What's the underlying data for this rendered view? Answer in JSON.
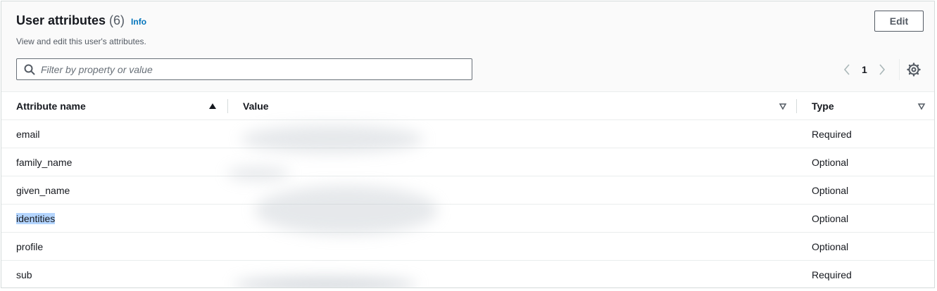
{
  "header": {
    "title": "User attributes",
    "count": "(6)",
    "info_label": "Info",
    "description": "View and edit this user's attributes.",
    "edit_label": "Edit"
  },
  "search": {
    "placeholder": "Filter by property or value",
    "value": ""
  },
  "pagination": {
    "current_page": "1",
    "prev_icon": "chevron-left-icon",
    "next_icon": "chevron-right-icon",
    "settings_icon": "gear-icon"
  },
  "table": {
    "columns": [
      {
        "label": "Attribute name",
        "sort": "ascending"
      },
      {
        "label": "Value",
        "sort": "none"
      },
      {
        "label": "Type",
        "sort": "none"
      }
    ],
    "rows": [
      {
        "name": "email",
        "value": "",
        "type": "Required"
      },
      {
        "name": "family_name",
        "value": "",
        "type": "Optional"
      },
      {
        "name": "given_name",
        "value": "",
        "type": "Optional"
      },
      {
        "name": "identities",
        "value": "",
        "type": "Optional"
      },
      {
        "name": "profile",
        "value": "",
        "type": "Optional"
      },
      {
        "name": "sub",
        "value": "",
        "type": "Required"
      }
    ]
  },
  "colors": {
    "link": "#0073bb",
    "text": "#16191f",
    "muted": "#545b64",
    "selection": "#b4d5fe"
  }
}
